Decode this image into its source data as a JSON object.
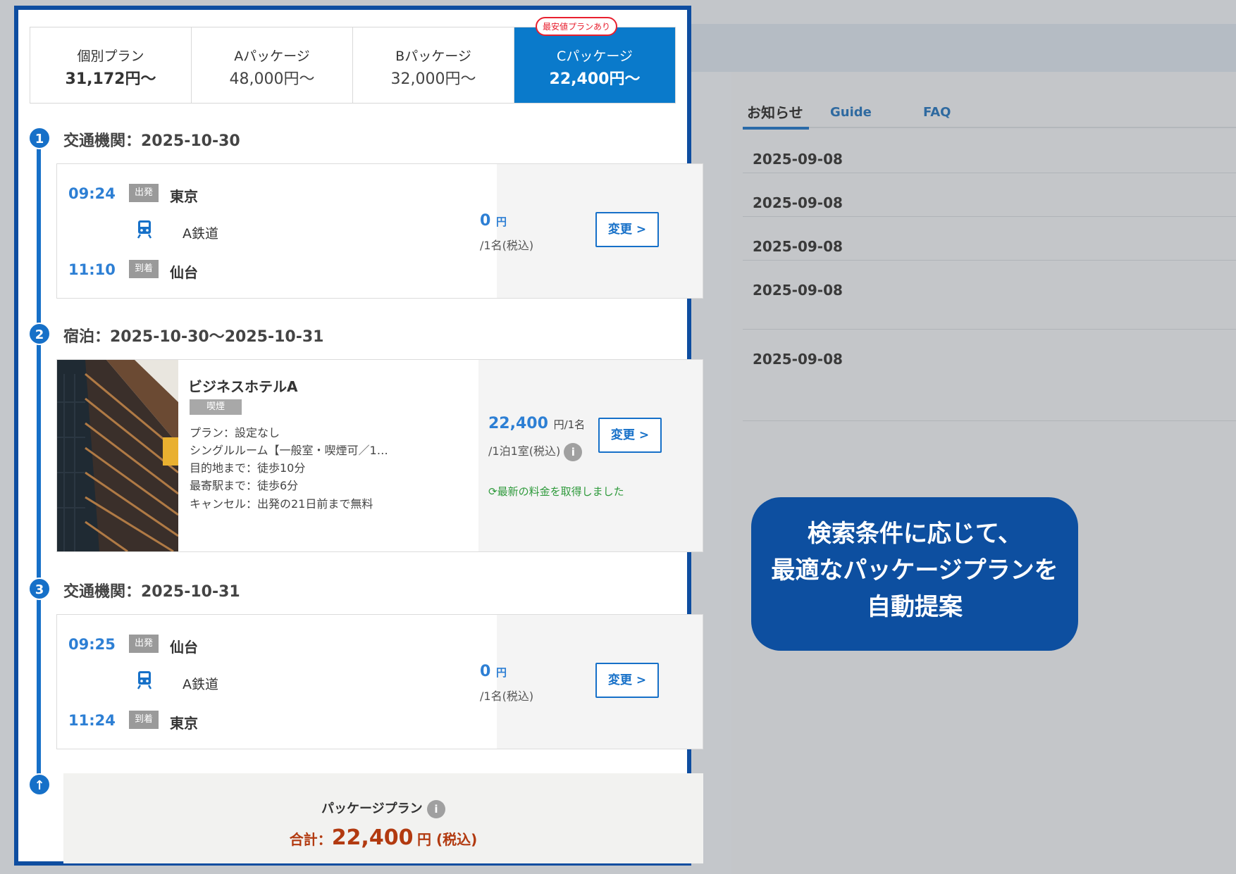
{
  "plans": [
    {
      "name": "個別プラン",
      "price": "31,172円〜"
    },
    {
      "name": "Aパッケージ",
      "price": "48,000円〜"
    },
    {
      "name": "Bパッケージ",
      "price": "32,000円〜"
    },
    {
      "name": "Cパッケージ",
      "price": "22,400円〜"
    }
  ],
  "best_badge": "最安値プランあり",
  "steps": {
    "s1": {
      "num": "1",
      "title": "交通機関：2025-10-30"
    },
    "s2": {
      "num": "2",
      "title": "宿泊：2025-10-30〜2025-10-31"
    },
    "s3": {
      "num": "3",
      "title": "交通機関：2025-10-31"
    },
    "top": "↑"
  },
  "transport1": {
    "dep_time": "09:24",
    "dep_tag": "出発",
    "dep_station": "東京",
    "railway": "A鉄道",
    "arr_time": "11:10",
    "arr_tag": "到着",
    "arr_station": "仙台",
    "price": "0",
    "price_unit": "円",
    "price_sub": "/1名(税込)",
    "change": "変更 >"
  },
  "hotel": {
    "name": "ビジネスホテルA",
    "smoke": "喫煙",
    "plan": "プラン：設定なし",
    "room": "シングルルーム【一般室・喫煙可／1…",
    "dest": "目的地まで：徒歩10分",
    "station": "最寄駅まで：徒歩6分",
    "cancel": "キャンセル：出発の21日前まで無料",
    "price": "22,400",
    "price_unit": "円/1名",
    "price_sub": "/1泊1室(税込)",
    "info": "i",
    "refresh": "最新の料金を取得しました",
    "change": "変更 >"
  },
  "transport2": {
    "dep_time": "09:25",
    "dep_tag": "出発",
    "dep_station": "仙台",
    "railway": "A鉄道",
    "arr_time": "11:24",
    "arr_tag": "到着",
    "arr_station": "東京",
    "price": "0",
    "price_unit": "円",
    "price_sub": "/1名(税込)",
    "change": "変更 >"
  },
  "summary": {
    "label": "パッケージプラン",
    "info": "i",
    "total_label": "合計：",
    "total": "22,400",
    "unit": "円 (税込)"
  },
  "info_panel": {
    "tabs": [
      "お知らせ",
      "Guide",
      "FAQ"
    ],
    "dates": [
      "2025-09-08",
      "2025-09-08",
      "2025-09-08",
      "2025-09-08",
      "2025-09-08"
    ]
  },
  "callout": {
    "line1": "検索条件に応じて、",
    "line2": "最適なパッケージプランを",
    "line3": "自動提案"
  },
  "colors": {
    "frame": "#0e4da0",
    "selected_tab": "#0a7acb",
    "accent": "#2d7fd4",
    "total": "#b23a10",
    "refresh": "#2f9a3c",
    "badge": "#e8202f"
  }
}
